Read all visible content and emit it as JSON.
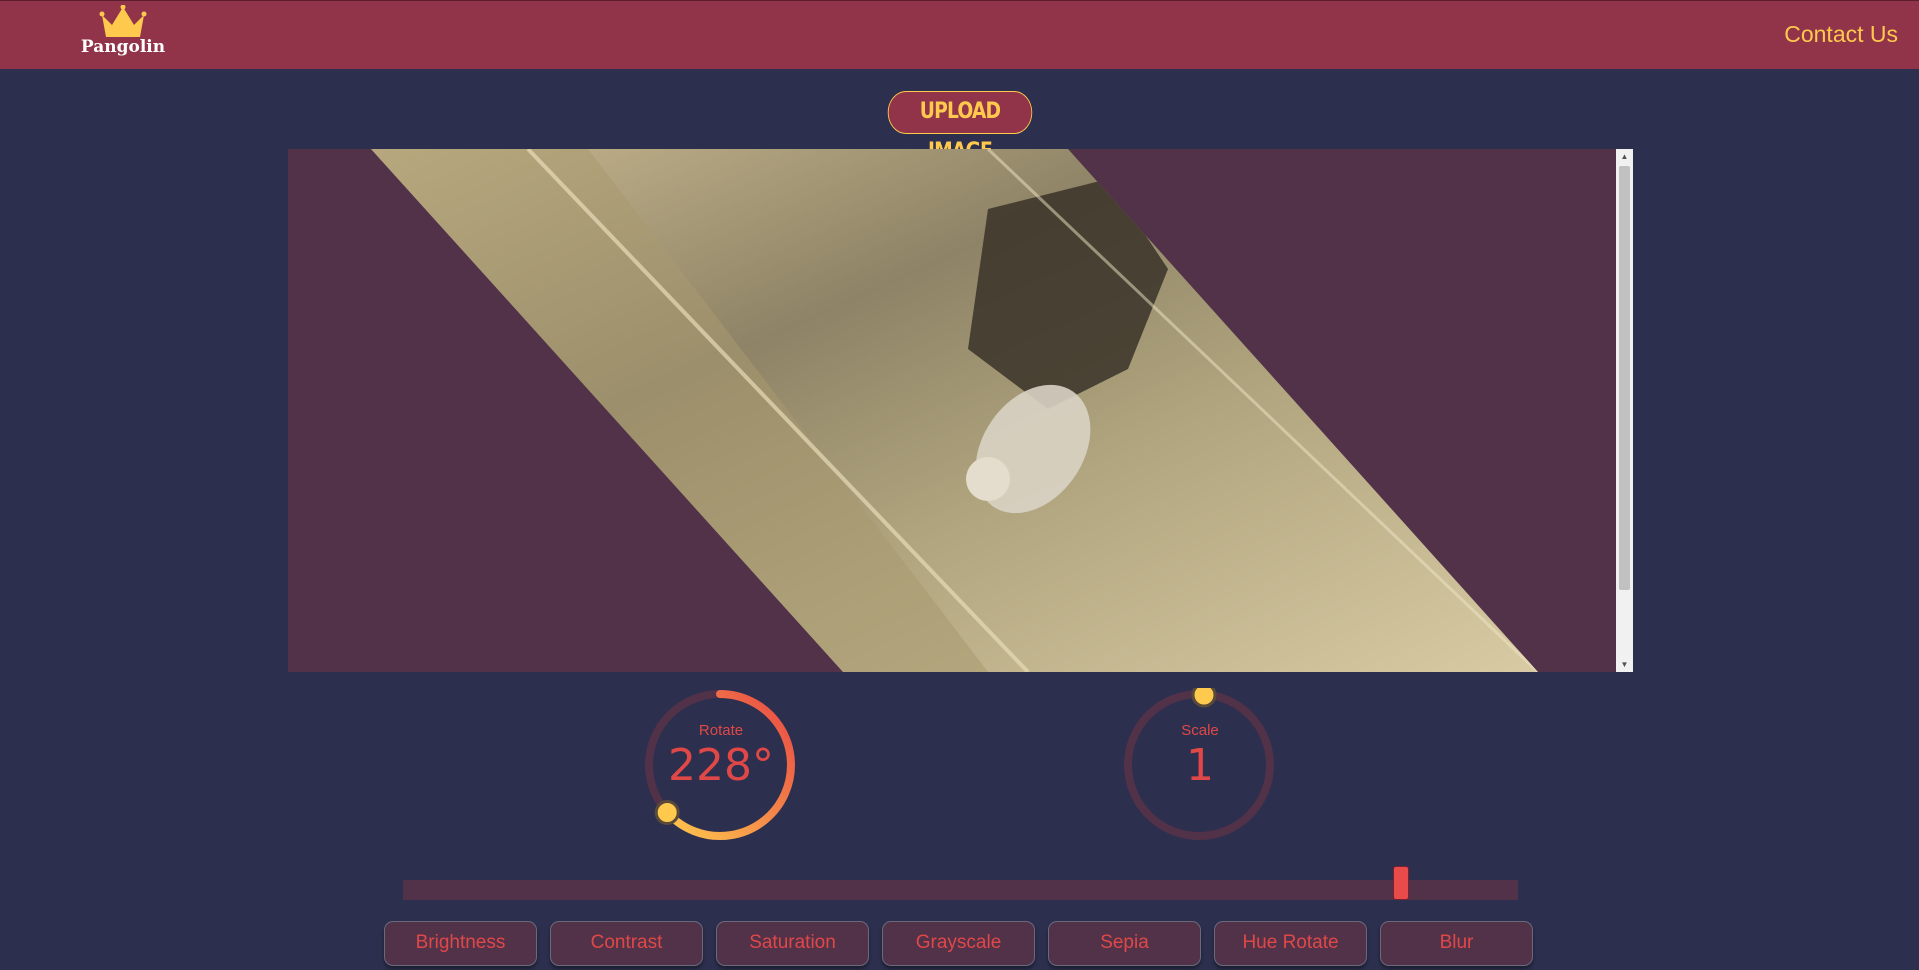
{
  "header": {
    "logo_text": "Pangolin",
    "contact_label": "Contact Us"
  },
  "upload": {
    "label": "UPLOAD IMAGE"
  },
  "rotate": {
    "label": "Rotate",
    "value": "228°",
    "degrees": 228
  },
  "scale": {
    "label": "Scale",
    "value": "1"
  },
  "slider": {
    "value_fraction": 0.895
  },
  "filters": [
    {
      "label": "Brightness"
    },
    {
      "label": "Contrast"
    },
    {
      "label": "Saturation"
    },
    {
      "label": "Grayscale"
    },
    {
      "label": "Sepia"
    },
    {
      "label": "Hue Rotate"
    },
    {
      "label": "Blur"
    }
  ],
  "colors": {
    "background": "#2c2f4d",
    "header": "#913449",
    "accent_yellow": "#ffc94d",
    "accent_red": "#e04848",
    "panel": "#513249"
  }
}
